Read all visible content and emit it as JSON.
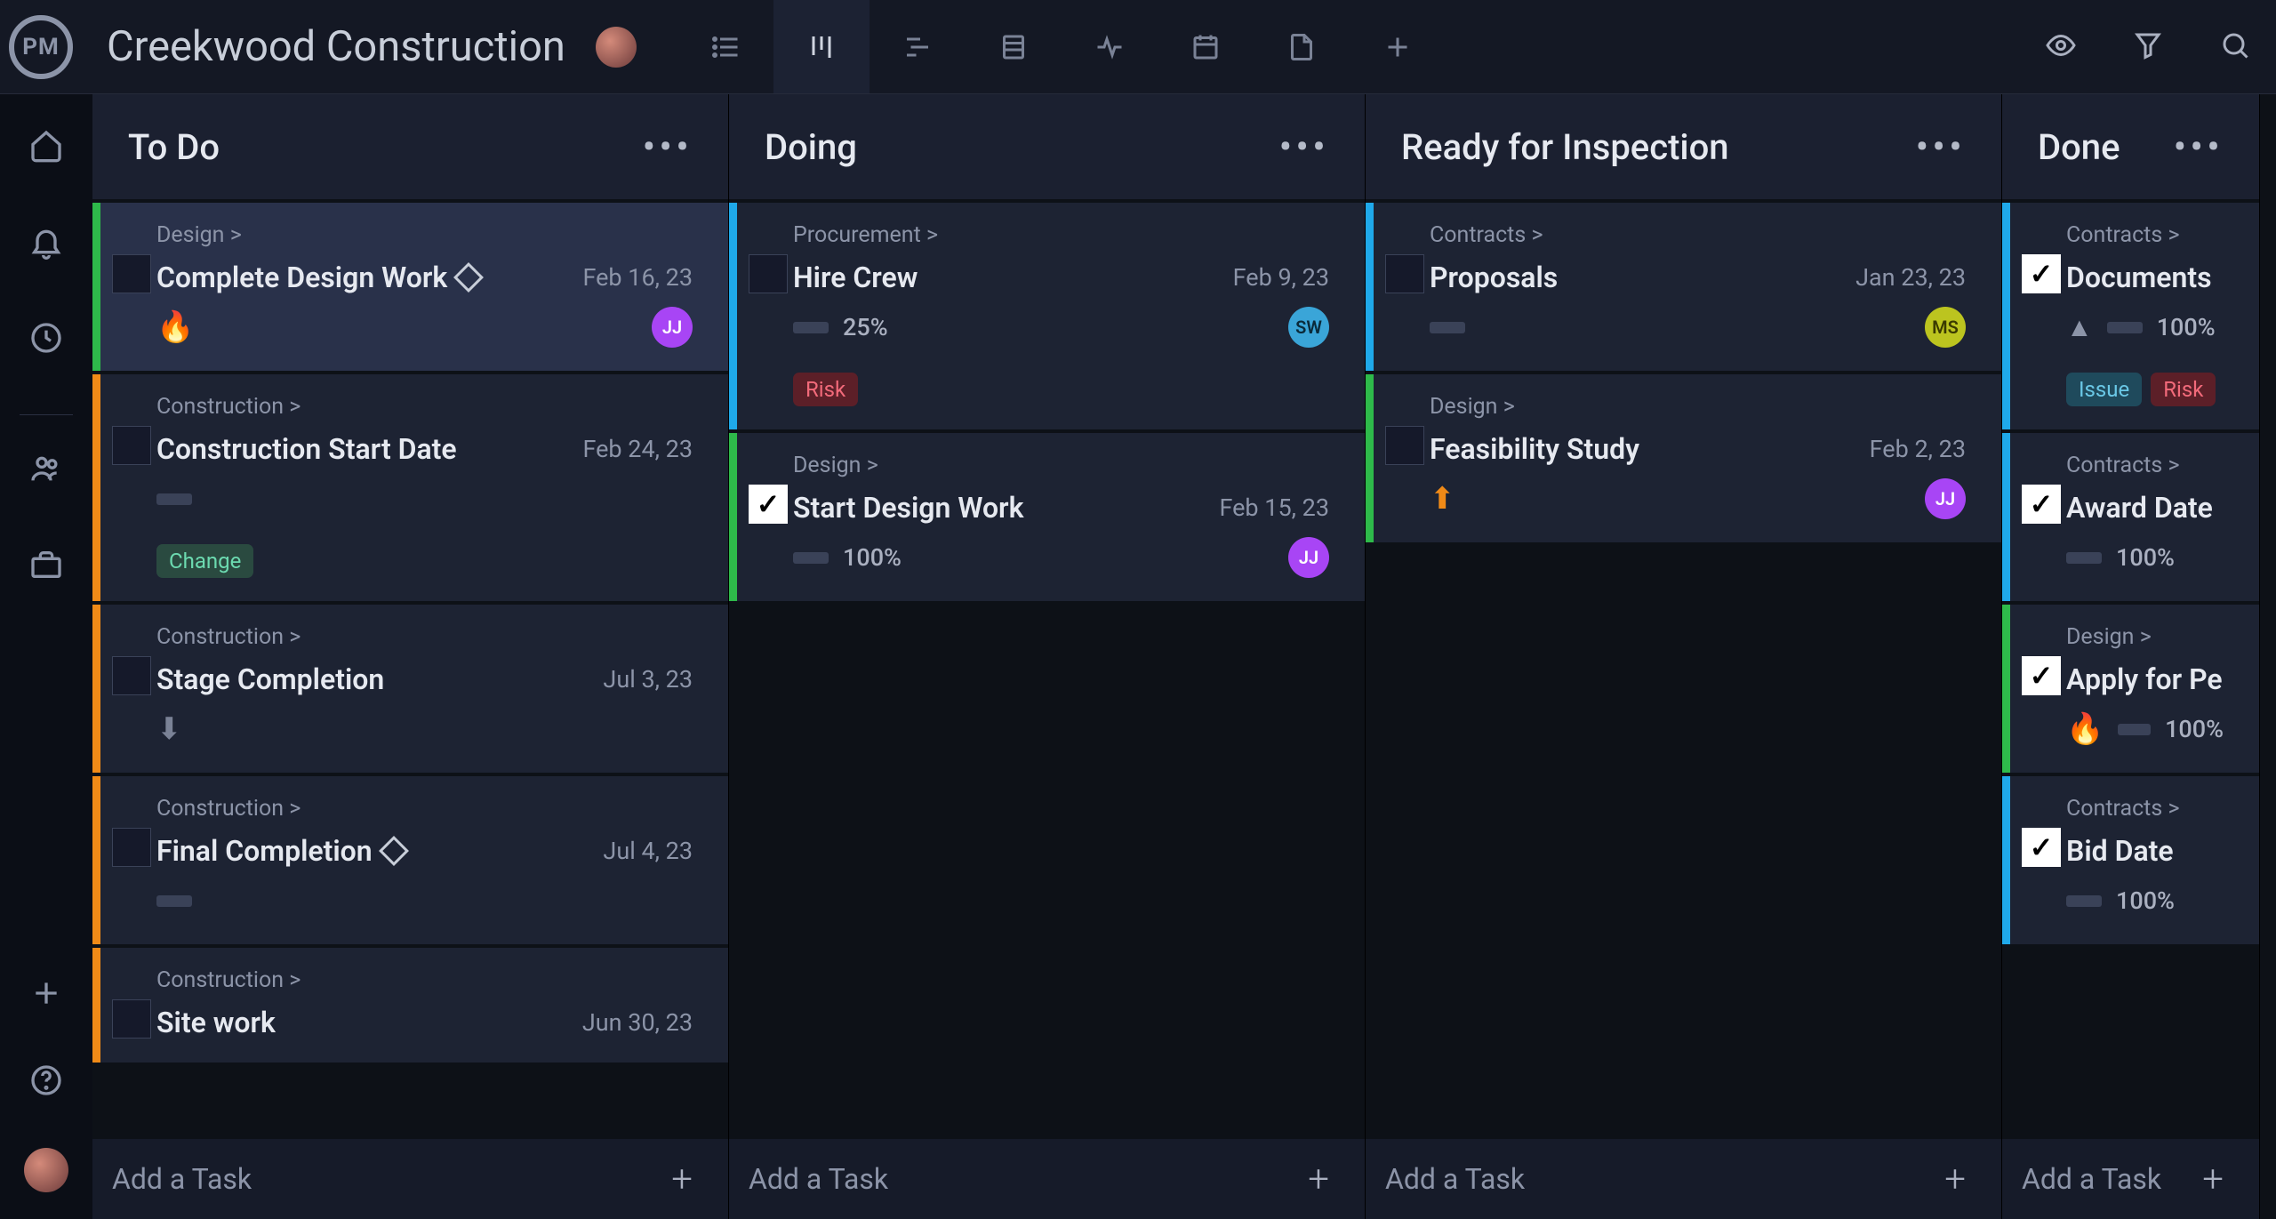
{
  "logo_text": "PM",
  "project_title": "Creekwood Construction",
  "add_task_label": "Add a Task",
  "columns": [
    {
      "title": "To Do",
      "cards": [
        {
          "category": "Design >",
          "title": "Complete Design Work",
          "date": "Feb 16, 23",
          "stripe": "green",
          "checked": false,
          "diamond": true,
          "flame": true,
          "avatar": "JJ",
          "avatar_class": "jj",
          "hover": true
        },
        {
          "category": "Construction >",
          "title": "Construction Start Date",
          "date": "Feb 24, 23",
          "stripe": "orange",
          "checked": false,
          "progress_bar": true,
          "tags": [
            {
              "text": "Change",
              "cls": "change"
            }
          ]
        },
        {
          "category": "Construction >",
          "title": "Stage Completion",
          "date": "Jul 3, 23",
          "stripe": "orange",
          "checked": false,
          "arrow_down": true
        },
        {
          "category": "Construction >",
          "title": "Final Completion",
          "date": "Jul 4, 23",
          "stripe": "orange",
          "checked": false,
          "diamond": true,
          "progress_bar": true
        },
        {
          "category": "Construction >",
          "title": "Site work",
          "date": "Jun 30, 23",
          "stripe": "orange",
          "checked": false
        }
      ]
    },
    {
      "title": "Doing",
      "cards": [
        {
          "category": "Procurement >",
          "title": "Hire Crew",
          "date": "Feb 9, 23",
          "stripe": "blue",
          "checked": false,
          "progress": "25%",
          "avatar": "SW",
          "avatar_class": "sw",
          "tags": [
            {
              "text": "Risk",
              "cls": "risk"
            }
          ]
        },
        {
          "category": "Design >",
          "title": "Start Design Work",
          "date": "Feb 15, 23",
          "stripe": "green",
          "checked": true,
          "progress": "100%",
          "avatar": "JJ",
          "avatar_class": "jj"
        }
      ]
    },
    {
      "title": "Ready for Inspection",
      "cards": [
        {
          "category": "Contracts >",
          "title": "Proposals",
          "date": "Jan 23, 23",
          "stripe": "blue",
          "checked": false,
          "progress_bar": true,
          "avatar": "MS",
          "avatar_class": "ms"
        },
        {
          "category": "Design >",
          "title": "Feasibility Study",
          "date": "Feb 2, 23",
          "stripe": "green",
          "checked": false,
          "arrow_up": true,
          "avatar": "JJ",
          "avatar_class": "jj"
        }
      ]
    },
    {
      "title": "Done",
      "cards": [
        {
          "category": "Contracts >",
          "title": "Documents",
          "stripe": "blue",
          "checked": true,
          "arrow_up_grey": true,
          "progress": "100%",
          "tags": [
            {
              "text": "Issue",
              "cls": "issue"
            },
            {
              "text": "Risk",
              "cls": "risk"
            }
          ]
        },
        {
          "category": "Contracts >",
          "title": "Award Date",
          "stripe": "blue",
          "checked": true,
          "progress": "100%",
          "progress_bar": true
        },
        {
          "category": "Design >",
          "title": "Apply for Pe",
          "stripe": "green",
          "checked": true,
          "flame": true,
          "progress": "100%"
        },
        {
          "category": "Contracts >",
          "title": "Bid Date",
          "stripe": "blue",
          "checked": true,
          "progress": "100%",
          "progress_bar": true
        }
      ]
    }
  ]
}
